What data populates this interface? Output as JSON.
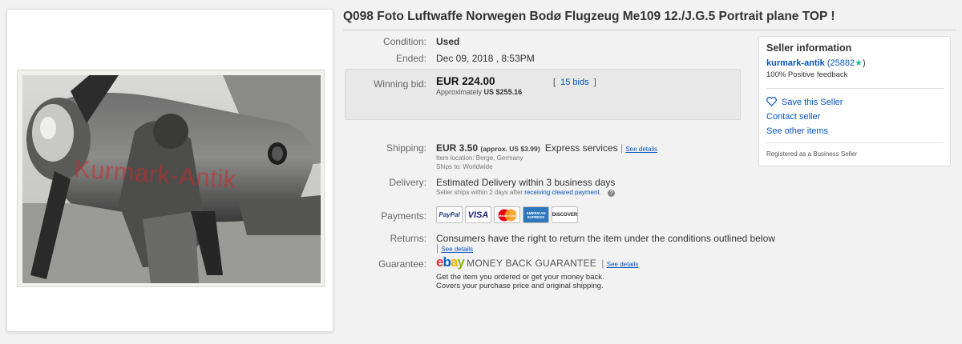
{
  "item": {
    "title": "Q098 Foto Luftwaffe Norwegen Bodø Flugzeug Me109 12./J.G.5 Portrait plane TOP !",
    "photo_watermark": "Kurmark-Antik"
  },
  "details": {
    "condition_label": "Condition:",
    "condition_value": "Used",
    "ended_label": "Ended:",
    "ended_value": "Dec 09, 2018 , 8:53PM"
  },
  "bid": {
    "label": "Winning bid:",
    "price": "EUR 224.00",
    "approx_prefix": "Approximately",
    "approx_value": "US $255.16",
    "bids_open": "[",
    "bids_link": "15 bids",
    "bids_close": "]"
  },
  "shipping": {
    "label": "Shipping:",
    "cost": "EUR 3.50",
    "approx": "(approx. US $3.99)",
    "service": "Express services",
    "see_details": "See details",
    "location": "Item location:  Berge, Germany",
    "ships_to": "Ships to:  Worldwide"
  },
  "delivery": {
    "label": "Delivery:",
    "text": "Estimated Delivery within 3 business days",
    "note_prefix": "Seller ships within 2 days after",
    "note_link": "receiving cleared payment",
    "note_suffix": "."
  },
  "payments": {
    "label": "Payments:",
    "methods": [
      "PayPal",
      "VISA",
      "MasterCard",
      "AMERICAN EXPRESS",
      "DISCOVER"
    ]
  },
  "returns": {
    "label": "Returns:",
    "text": "Consumers have the right to return the item under the conditions outlined below",
    "see_details": "See details"
  },
  "guarantee": {
    "label": "Guarantee:",
    "logo_e": "e",
    "logo_b": "b",
    "logo_a": "a",
    "logo_y": "y",
    "mbg": "MONEY BACK GUARANTEE",
    "see_details": "See details",
    "line1": "Get the item you ordered or get your money back.",
    "line2": "Covers your purchase price and original shipping."
  },
  "seller": {
    "heading": "Seller information",
    "name": "kurmark-antik",
    "score_open": "(25882",
    "score_close": ")",
    "feedback": "100% Positive feedback",
    "save": "Save this Seller",
    "contact": "Contact seller",
    "other_items": "See other items",
    "registered": "Registered as a Business Seller"
  },
  "colors": {
    "link": "#0654ba",
    "price": "#111111",
    "ebay_red": "#e53238",
    "ebay_blue": "#0064d2",
    "ebay_yellow": "#f5af02",
    "ebay_green": "#86b817"
  }
}
